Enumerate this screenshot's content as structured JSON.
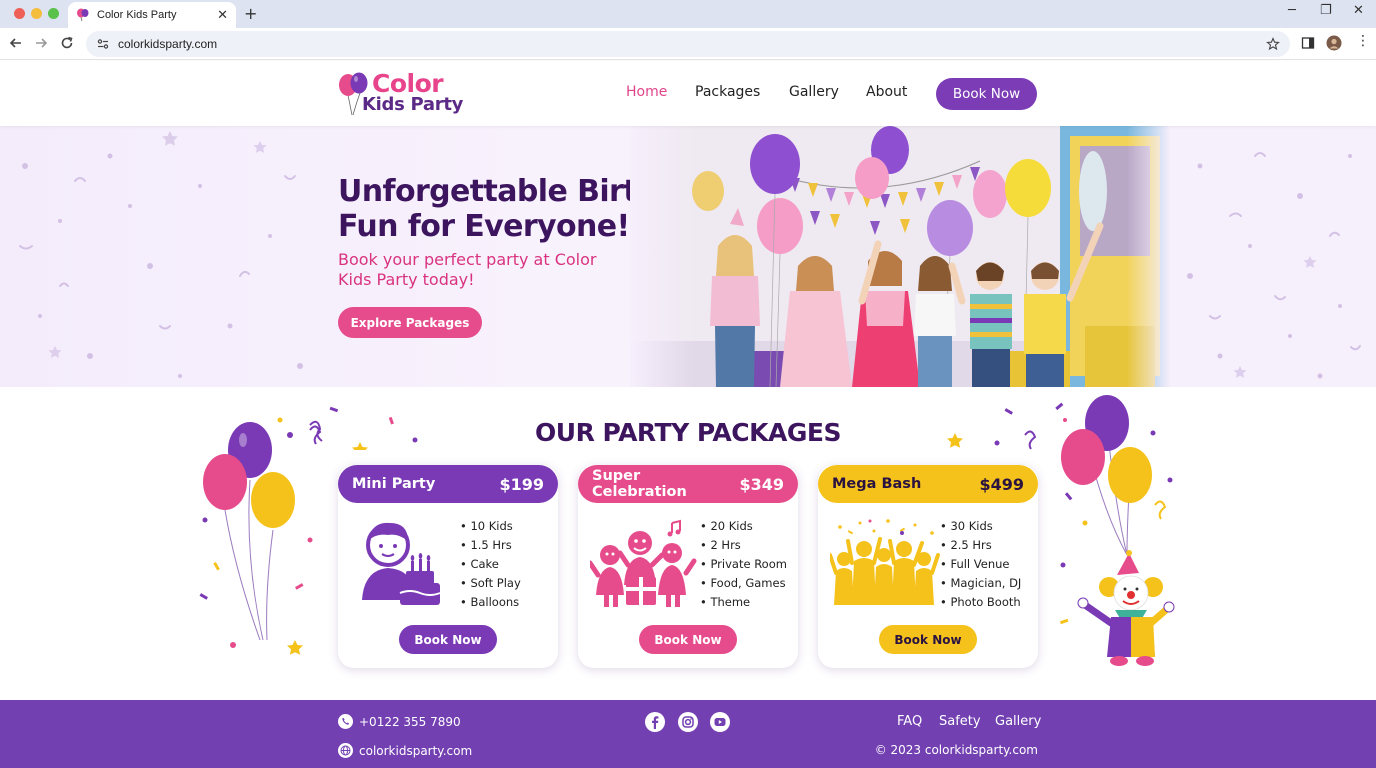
{
  "browser": {
    "tab_title": "Color Kids Party",
    "url": "colorkidsparty.com"
  },
  "header": {
    "logo_line1": "Color",
    "logo_line2": "Kids Party",
    "nav": [
      {
        "label": "Home",
        "active": true
      },
      {
        "label": "Packages",
        "active": false
      },
      {
        "label": "Gallery",
        "active": false
      },
      {
        "label": "About",
        "active": false
      }
    ],
    "book_now": "Book Now"
  },
  "hero": {
    "title": "Unforgettable Birthday Fun for Everyone!",
    "subtitle": "Book your perfect party at Color Kids Party today!",
    "cta": "Explore Packages"
  },
  "packages": {
    "title": "OUR PARTY PACKAGES",
    "items": [
      {
        "name": "Mini Party",
        "price": "$199",
        "features": [
          "10 Kids",
          "1.5 Hrs",
          "Cake",
          "Soft Play",
          "Balloons"
        ],
        "button": "Book Now",
        "color": "#7a3ab5"
      },
      {
        "name": "Super Celebration",
        "price": "$349",
        "features": [
          "20 Kids",
          "2 Hrs",
          "Private Room",
          "Food, Games",
          "Theme"
        ],
        "button": "Book Now",
        "color": "#e64c8c"
      },
      {
        "name": "Mega Bash",
        "price": "$499",
        "features": [
          "30 Kids",
          "2.5 Hrs",
          "Full Venue",
          "Magician, DJ",
          "Photo Booth"
        ],
        "button": "Book Now",
        "color": "#f5c21b"
      }
    ]
  },
  "footer": {
    "phone": "+0122 355 7890",
    "website": "colorkidsparty.com",
    "links": [
      "FAQ",
      "Safety",
      "Gallery"
    ],
    "copyright": "© 2023 colorkidsparty.com",
    "social": [
      "facebook-icon",
      "instagram-icon",
      "youtube-icon"
    ]
  },
  "colors": {
    "purple": "#7a3ab5",
    "pink": "#e64c8c",
    "yellow": "#f5c21b",
    "dark_purple": "#3d155f",
    "footer": "#7340b2"
  }
}
